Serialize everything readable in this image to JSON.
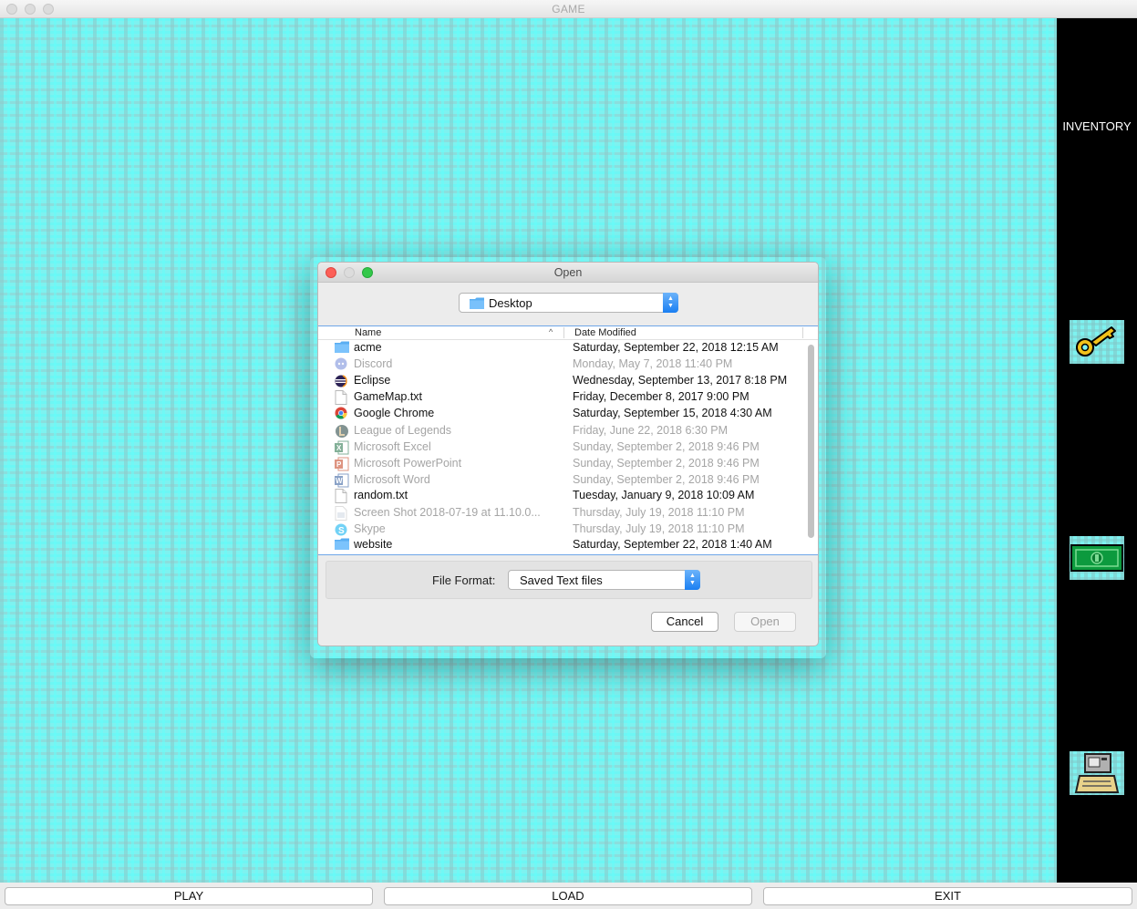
{
  "window": {
    "title": "GAME"
  },
  "inventory": {
    "title": "INVENTORY",
    "items": [
      "key-icon",
      "cash-icon",
      "computer-icon"
    ]
  },
  "bottom_buttons": {
    "play": "PLAY",
    "load": "LOAD",
    "exit": "EXIT"
  },
  "dialog": {
    "title": "Open",
    "location": "Desktop",
    "columns": {
      "name": "Name",
      "date_modified": "Date Modified"
    },
    "files": [
      {
        "name": "acme",
        "date": "Saturday, September 22, 2018 12:15 AM",
        "icon": "folder-icon",
        "enabled": true
      },
      {
        "name": "Discord",
        "date": "Monday, May 7, 2018 11:40 PM",
        "icon": "discord-icon",
        "enabled": false
      },
      {
        "name": "Eclipse",
        "date": "Wednesday, September 13, 2017 8:18 PM",
        "icon": "eclipse-icon",
        "enabled": true
      },
      {
        "name": "GameMap.txt",
        "date": "Friday, December 8, 2017 9:00 PM",
        "icon": "document-icon",
        "enabled": true
      },
      {
        "name": "Google Chrome",
        "date": "Saturday, September 15, 2018 4:30 AM",
        "icon": "chrome-icon",
        "enabled": true
      },
      {
        "name": "League of Legends",
        "date": "Friday, June 22, 2018 6:30 PM",
        "icon": "league-icon",
        "enabled": false
      },
      {
        "name": "Microsoft Excel",
        "date": "Sunday, September 2, 2018 9:46 PM",
        "icon": "excel-icon",
        "enabled": false
      },
      {
        "name": "Microsoft PowerPoint",
        "date": "Sunday, September 2, 2018 9:46 PM",
        "icon": "powerpoint-icon",
        "enabled": false
      },
      {
        "name": "Microsoft Word",
        "date": "Sunday, September 2, 2018 9:46 PM",
        "icon": "word-icon",
        "enabled": false
      },
      {
        "name": "random.txt",
        "date": "Tuesday, January 9, 2018 10:09 AM",
        "icon": "document-icon",
        "enabled": true
      },
      {
        "name": "Screen Shot 2018-07-19 at 11.10.0...",
        "date": "Thursday, July 19, 2018 11:10 PM",
        "icon": "image-file-icon",
        "enabled": false
      },
      {
        "name": "Skype",
        "date": "Thursday, July 19, 2018 11:10 PM",
        "icon": "skype-icon",
        "enabled": false
      },
      {
        "name": "website",
        "date": "Saturday, September 22, 2018 1:40 AM",
        "icon": "folder-icon",
        "enabled": true
      }
    ],
    "file_format_label": "File Format:",
    "file_format_value": "Saved Text files",
    "cancel_label": "Cancel",
    "open_label": "Open"
  }
}
